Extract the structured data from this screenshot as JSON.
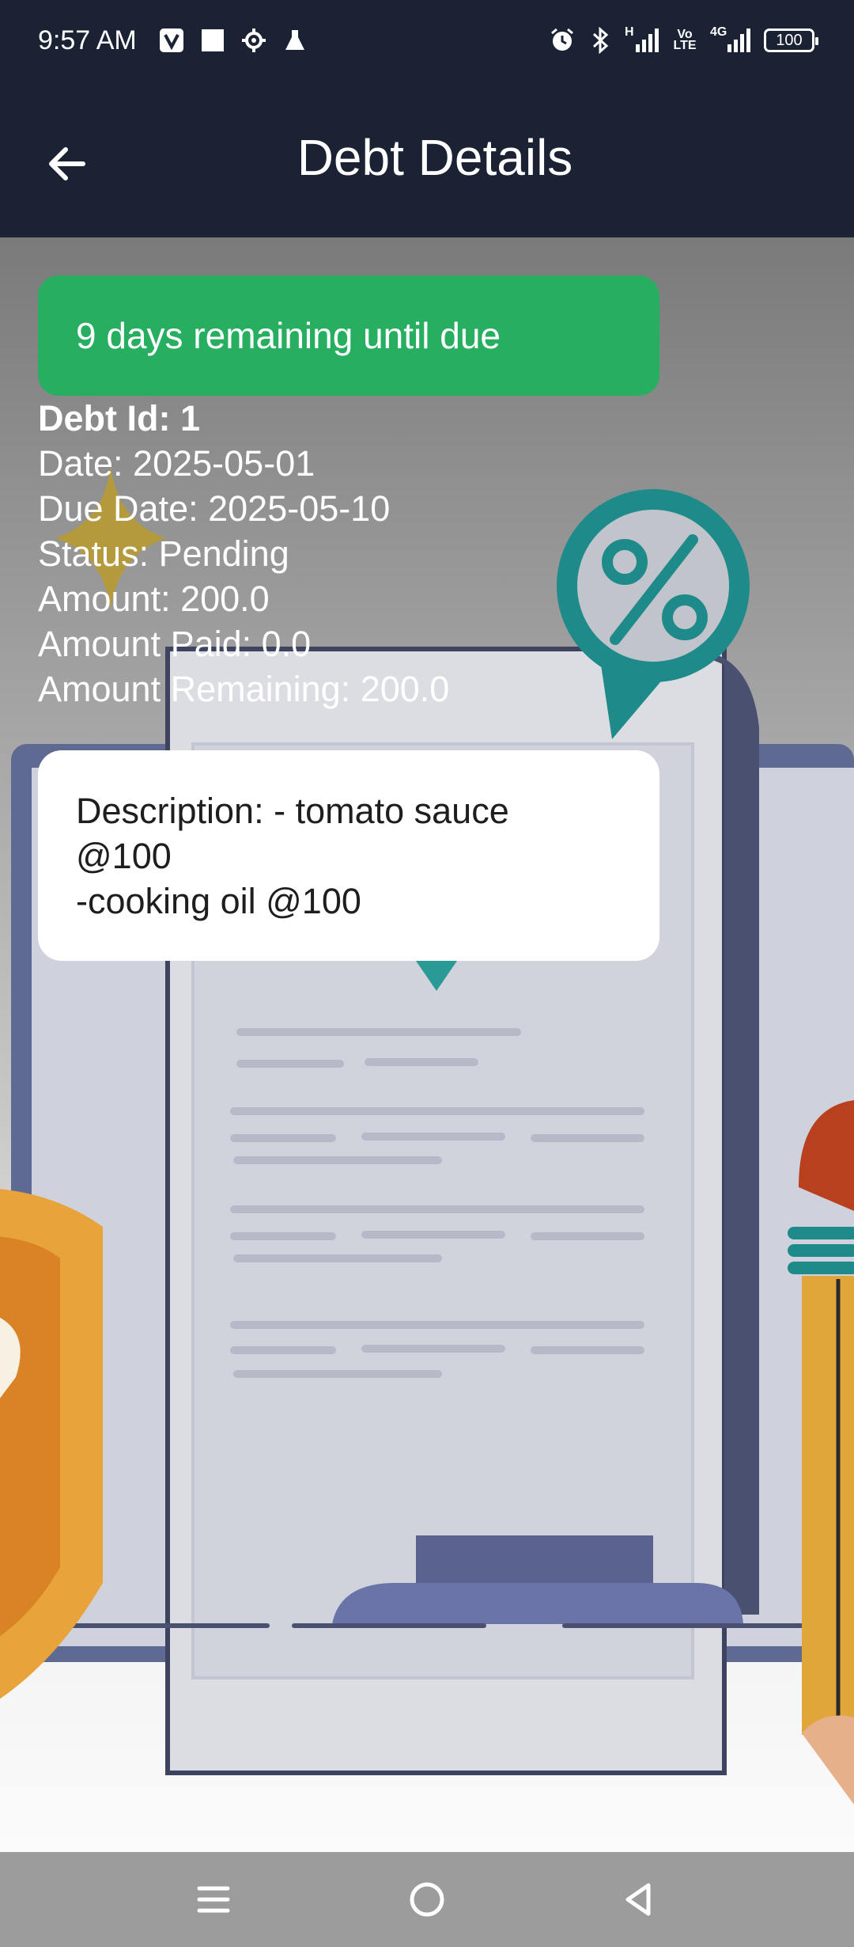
{
  "status_bar": {
    "time": "9:57 AM",
    "left_icons": [
      "v-app-icon",
      "square-notification-icon",
      "gear-notification-icon",
      "flask-notification-icon"
    ],
    "right_icons": [
      "alarm-icon",
      "bluetooth-icon",
      "signal-icon",
      "volte-icon",
      "signal-4g-icon"
    ],
    "network_h": "H",
    "volte_text_top": "Vo",
    "volte_text_bottom": "LTE",
    "network_4g": "4G",
    "battery_level": "100"
  },
  "app_bar": {
    "title": "Debt Details",
    "back_icon": "arrow-left-icon"
  },
  "due_banner": {
    "text": "9 days remaining until due",
    "color": "#27ae60"
  },
  "debt": {
    "id_line": "Debt Id: 1",
    "date_line": "Date: 2025-05-01",
    "due_date_line": "Due Date: 2025-05-10",
    "status_line": "Status: Pending",
    "amount_line": "Amount: 200.0",
    "amount_paid_line": "Amount Paid: 0.0",
    "amount_remaining_line": "Amount Remaining: 200.0"
  },
  "description": {
    "text": "Description: - tomato sauce\n@100\n-cooking oil @100"
  },
  "nav_bar": {
    "buttons": [
      "menu-icon",
      "home-icon",
      "back-triangle-icon"
    ]
  },
  "colors": {
    "header": "#1b2233",
    "nav": "#9c9c9c",
    "accent_green": "#27ae60"
  }
}
